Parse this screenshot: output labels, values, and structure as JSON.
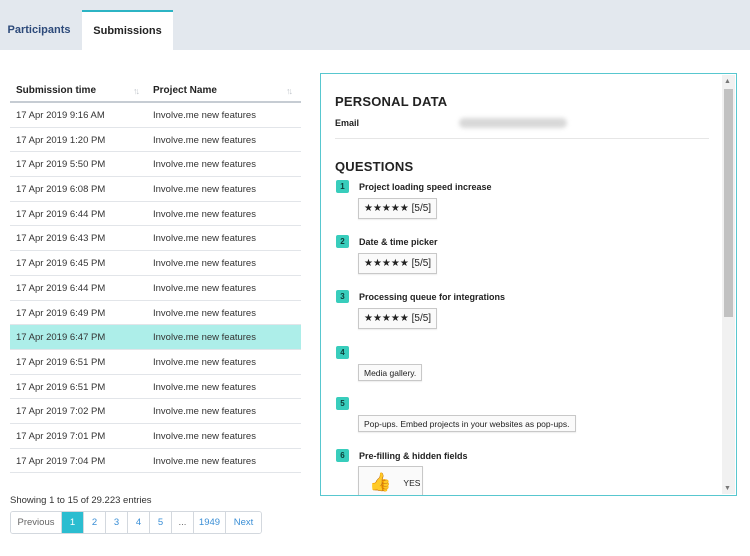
{
  "tabs": [
    {
      "label": "Participants",
      "active": false
    },
    {
      "label": "Submissions",
      "active": true
    }
  ],
  "table": {
    "columns": [
      "Submission time",
      "Project Name"
    ],
    "rows": [
      {
        "time": "17 Apr 2019 9:16 AM",
        "project": "Involve.me new features"
      },
      {
        "time": "17 Apr 2019 1:20 PM",
        "project": "Involve.me new features"
      },
      {
        "time": "17 Apr 2019 5:50 PM",
        "project": "Involve.me new features"
      },
      {
        "time": "17 Apr 2019 6:08 PM",
        "project": "Involve.me new features"
      },
      {
        "time": "17 Apr 2019 6:44 PM",
        "project": "Involve.me new features"
      },
      {
        "time": "17 Apr 2019 6:43 PM",
        "project": "Involve.me new features"
      },
      {
        "time": "17 Apr 2019 6:45 PM",
        "project": "Involve.me new features"
      },
      {
        "time": "17 Apr 2019 6:44 PM",
        "project": "Involve.me new features"
      },
      {
        "time": "17 Apr 2019 6:49 PM",
        "project": "Involve.me new features"
      },
      {
        "time": "17 Apr 2019 6:47 PM",
        "project": "Involve.me new features"
      },
      {
        "time": "17 Apr 2019 6:51 PM",
        "project": "Involve.me new features"
      },
      {
        "time": "17 Apr 2019 6:51 PM",
        "project": "Involve.me new features"
      },
      {
        "time": "17 Apr 2019 7:02 PM",
        "project": "Involve.me new features"
      },
      {
        "time": "17 Apr 2019 7:01 PM",
        "project": "Involve.me new features"
      },
      {
        "time": "17 Apr 2019 7:04 PM",
        "project": "Involve.me new features"
      }
    ],
    "selected_row_index": 9,
    "entries_text": "Showing 1 to 15 of 29.223 entries"
  },
  "pagination": {
    "prev": "Previous",
    "pages": [
      "1",
      "2",
      "3",
      "4",
      "5"
    ],
    "active_page": "1",
    "ellipsis": "...",
    "last": "1949",
    "next": "Next"
  },
  "detail": {
    "personal_heading": "PERSONAL DATA",
    "email_label": "Email",
    "questions_heading": "QUESTIONS",
    "questions": [
      {
        "num": "1",
        "title": "Project loading speed increase",
        "answer": "★★★★★ [5/5]"
      },
      {
        "num": "2",
        "title": "Date & time picker",
        "answer": "★★★★★ [5/5]"
      },
      {
        "num": "3",
        "title": "Processing queue for integrations",
        "answer": "★★★★★ [5/5]"
      },
      {
        "num": "4",
        "title": "",
        "answer": "Media gallery."
      },
      {
        "num": "5",
        "title": "",
        "answer": "Pop-ups. Embed projects in your websites as pop-ups."
      },
      {
        "num": "6",
        "title": "Pre-filling & hidden fields",
        "answer": "YES"
      }
    ]
  },
  "icons": {
    "sort": "sort-arrows-icon",
    "thumb": "thumbs-up-icon",
    "scroll_up": "scroll-up-icon",
    "scroll_down": "scroll-down-icon"
  },
  "colors": {
    "accent": "#2bbdd0",
    "selected_row": "#adeee9",
    "badge": "#38cdbc",
    "panel_border": "#58c7cf"
  }
}
